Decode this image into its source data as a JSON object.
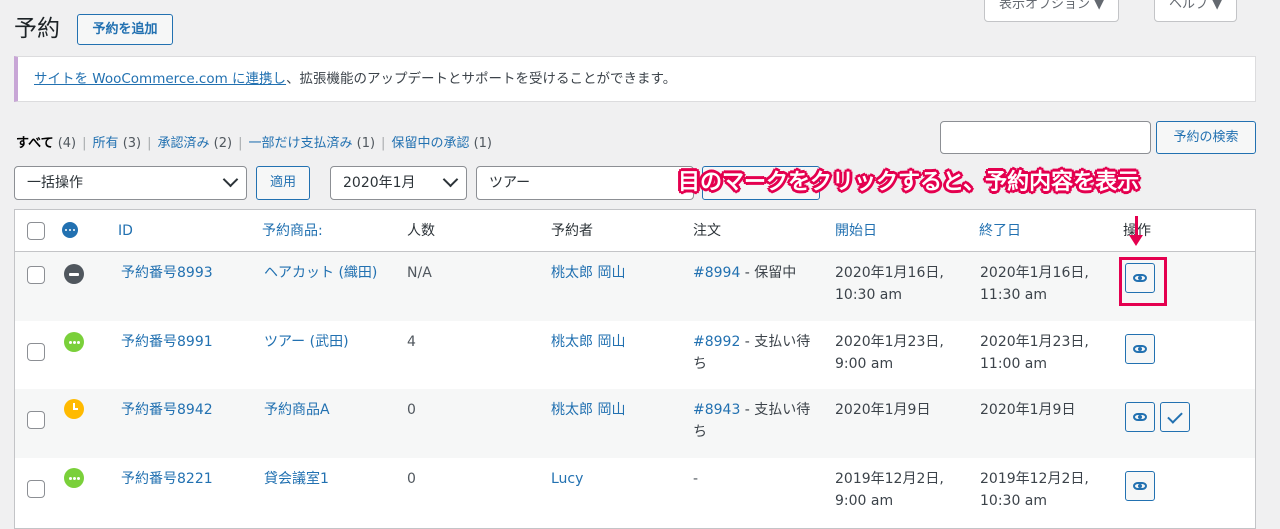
{
  "header": {
    "title": "予約",
    "add_button": "予約を追加",
    "screen_options": "表示オプション ▼",
    "help": "ヘルプ ▼"
  },
  "notice": {
    "link_text": "サイトを WooCommerce.com に連携し",
    "rest_text": "、拡張機能のアップデートとサポートを受けることができます。"
  },
  "views": [
    {
      "label": "すべて",
      "count": "(4)",
      "current": true
    },
    {
      "label": "所有",
      "count": "(3)"
    },
    {
      "label": "承認済み",
      "count": "(2)"
    },
    {
      "label": "一部だけ支払済み",
      "count": "(1)"
    },
    {
      "label": "保留中の承認",
      "count": "(1)"
    }
  ],
  "search": {
    "value": "",
    "button": "予約の検索"
  },
  "filters": {
    "bulk_action": "一括操作",
    "apply": "適用",
    "month": "2020年1月",
    "product": "ツアー"
  },
  "annotation": {
    "text": "目のマークをクリックすると、予約内容を表示",
    "color": "#e4004f"
  },
  "table": {
    "columns": [
      "ID",
      "予約商品:",
      "人数",
      "予約者",
      "注文",
      "開始日",
      "終了日",
      "操作"
    ],
    "rows": [
      {
        "status_icon": "status-unpaid-icon",
        "status_color": "#50575e",
        "id": "予約番号8993",
        "product": "ヘアカット (織田)",
        "persons": "N/A",
        "customer": "桃太郎 岡山",
        "order_link": "#8994",
        "order_status": " - 保留中",
        "order_status_2": "",
        "start_1": "2020年1月16日,",
        "start_2": "10:30 am",
        "end_1": "2020年1月16日,",
        "end_2": "11:30 am",
        "actions": [
          "view-icon"
        ]
      },
      {
        "status_icon": "status-confirmed-icon",
        "status_color": "#7ad03a",
        "id": "予約番号8991",
        "product": "ツアー (武田)",
        "persons": "4",
        "customer": "桃太郎 岡山",
        "order_link": "#8992",
        "order_status": " - 支払い待",
        "order_status_2": "ち",
        "start_1": "2020年1月23日,",
        "start_2": "9:00 am",
        "end_1": "2020年1月23日,",
        "end_2": "11:00 am",
        "actions": [
          "view-icon"
        ]
      },
      {
        "status_icon": "status-pending-icon",
        "status_color": "#ffba00",
        "id": "予約番号8942",
        "product": "予約商品A",
        "persons": "0",
        "customer": "桃太郎 岡山",
        "order_link": "#8943",
        "order_status": " - 支払い待",
        "order_status_2": "ち",
        "start_1": "2020年1月9日",
        "start_2": "",
        "end_1": "2020年1月9日",
        "end_2": "",
        "actions": [
          "view-icon",
          "confirm-icon"
        ]
      },
      {
        "status_icon": "status-confirmed-icon",
        "status_color": "#7ad03a",
        "id": "予約番号8221",
        "product": "貸会議室1",
        "persons": "0",
        "customer": "Lucy",
        "order_link": "",
        "order_status": "-",
        "order_status_2": "",
        "start_1": "2019年12月2日,",
        "start_2": "9:00 am",
        "end_1": "2019年12月2日,",
        "end_2": "10:30 am",
        "actions": [
          "view-icon"
        ]
      }
    ]
  }
}
